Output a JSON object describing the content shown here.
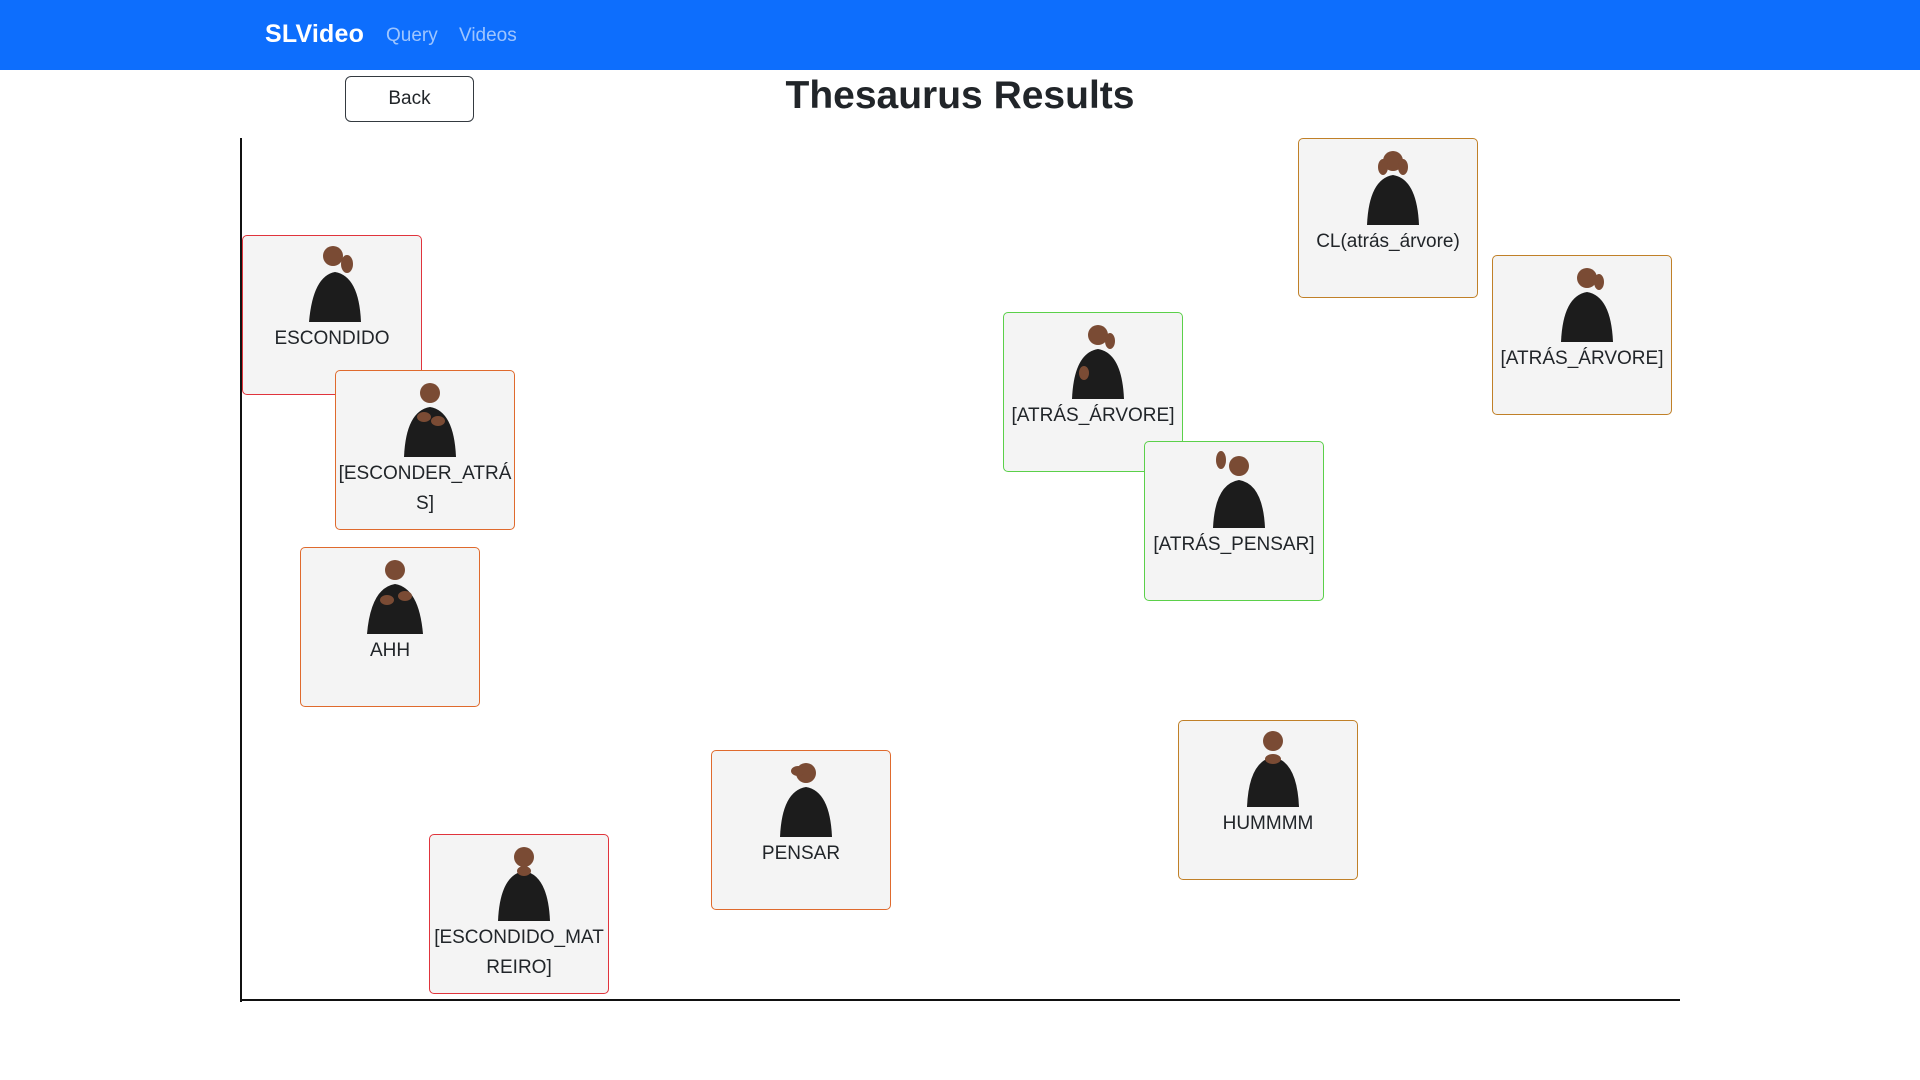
{
  "navbar": {
    "brand": "SLVideo",
    "links": [
      "Query",
      "Videos"
    ]
  },
  "back_button": "Back",
  "page_title": "Thesaurus Results",
  "colors": {
    "navbar_bg": "#0d6efd",
    "red": "#e0343c",
    "orange": "#df6a2d",
    "olive": "#c08028",
    "green": "#5bd04a"
  },
  "cards": [
    {
      "label": "CL(atrás_árvore)",
      "tone": "olive",
      "icon": "signer-thumbnail"
    },
    {
      "label": "[ATRÁS_ÁRVORE]",
      "tone": "olive",
      "icon": "signer-thumbnail"
    },
    {
      "label": "ESCONDIDO",
      "tone": "red",
      "icon": "signer-thumbnail"
    },
    {
      "label": "[ATRÁS_ÁRVORE]",
      "tone": "green",
      "icon": "signer-thumbnail"
    },
    {
      "label": "[ESCONDER_ATRÁS]",
      "tone": "orange",
      "icon": "signer-thumbnail"
    },
    {
      "label": "[ATRÁS_PENSAR]",
      "tone": "green",
      "icon": "signer-thumbnail"
    },
    {
      "label": "AHH",
      "tone": "orange",
      "icon": "signer-thumbnail"
    },
    {
      "label": "HUMMMM",
      "tone": "olive",
      "icon": "signer-thumbnail"
    },
    {
      "label": "PENSAR",
      "tone": "orange",
      "icon": "signer-thumbnail"
    },
    {
      "label": "[ESCONDIDO_MATREIRO]",
      "tone": "red",
      "icon": "signer-thumbnail"
    }
  ]
}
